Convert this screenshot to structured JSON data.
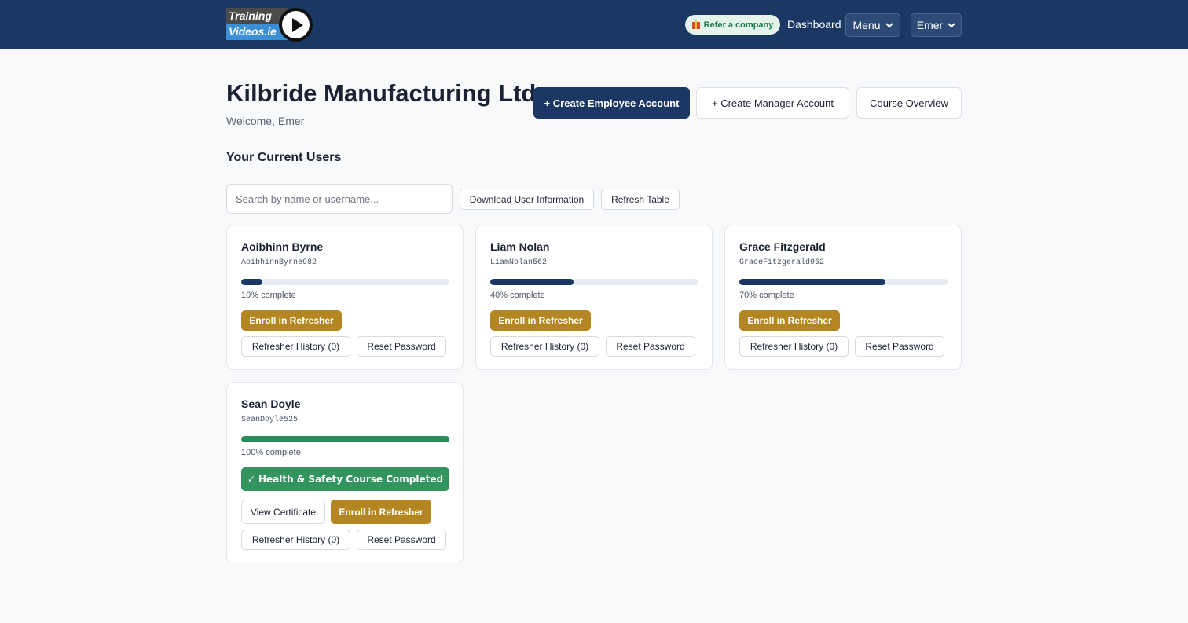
{
  "header": {
    "logo_line1": "Training",
    "logo_line2": "Videos.ie",
    "refer_label": "Refer a company",
    "dashboard_label": "Dashboard",
    "menu_label": "Menu",
    "user_label": "Emer"
  },
  "page": {
    "company_name": "Kilbride Manufacturing Ltd",
    "welcome": "Welcome, Emer",
    "create_employee_label": "+ Create Employee Account",
    "create_manager_label": "+ Create Manager Account",
    "course_overview_label": "Course Overview",
    "section_title": "Your Current Users"
  },
  "toolbar": {
    "search_placeholder": "Search by name or username...",
    "download_label": "Download User Information",
    "refresh_label": "Refresh Table"
  },
  "users": [
    {
      "name": "Aoibhinn Byrne",
      "username": "AoibhinnByrne982",
      "progress": 10,
      "progress_text": "10% complete",
      "enroll_label": "Enroll in Refresher",
      "history_label": "Refresher History (0)",
      "reset_label": "Reset Password"
    },
    {
      "name": "Liam Nolan",
      "username": "LiamNolan562",
      "progress": 40,
      "progress_text": "40% complete",
      "enroll_label": "Enroll in Refresher",
      "history_label": "Refresher History (0)",
      "reset_label": "Reset Password"
    },
    {
      "name": "Grace Fitzgerald",
      "username": "GraceFitzgerald962",
      "progress": 70,
      "progress_text": "70% complete",
      "enroll_label": "Enroll in Refresher",
      "history_label": "Refresher History (0)",
      "reset_label": "Reset Password"
    },
    {
      "name": "Sean Doyle",
      "username": "SeanDoyle525",
      "progress": 100,
      "progress_text": "100% complete",
      "completed_label": "Health & Safety Course Completed",
      "certificate_label": "View Certificate",
      "enroll_label": "Enroll in Refresher",
      "history_label": "Refresher History (0)",
      "reset_label": "Reset Password"
    }
  ],
  "colors": {
    "header_bg": "#1b3763",
    "primary": "#1b3763",
    "gold": "#b38621",
    "success": "#33945f"
  },
  "icons": {
    "refer": "gift-icon",
    "menu": "chevron-down-icon",
    "user": "chevron-down-icon",
    "completed": "check-icon",
    "logo": "play-icon"
  }
}
